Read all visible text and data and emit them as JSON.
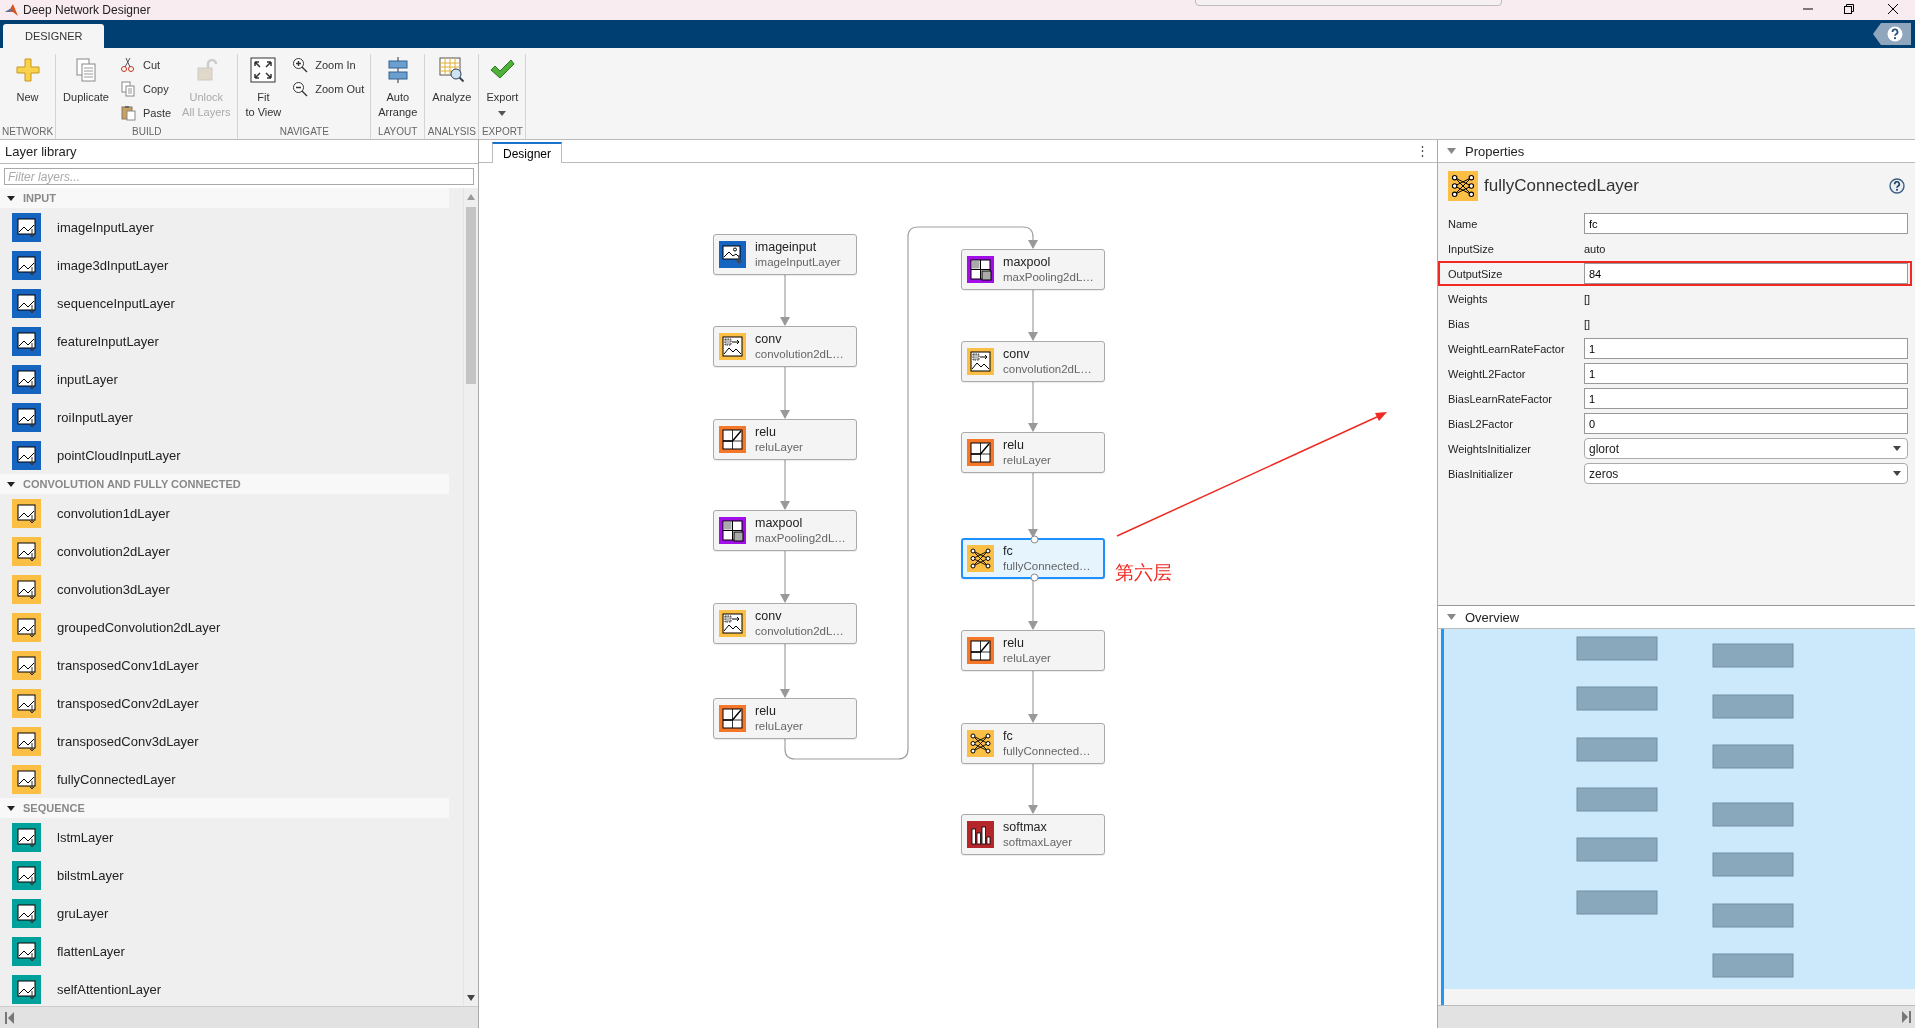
{
  "window": {
    "title": "Deep Network Designer"
  },
  "ribbon_tabs": [
    {
      "label": "DESIGNER",
      "selected": true
    }
  ],
  "toolbar": {
    "sections": [
      {
        "label": "NETWORK",
        "buttons": [
          {
            "label": "New",
            "kind": "large",
            "disabled": false
          }
        ]
      },
      {
        "label": "BUILD",
        "buttons": [
          {
            "label": "Duplicate",
            "kind": "large",
            "disabled": false
          },
          {
            "label": "Cut",
            "kind": "small",
            "disabled": false
          },
          {
            "label": "Copy",
            "kind": "small",
            "disabled": false
          },
          {
            "label": "Paste",
            "kind": "small",
            "disabled": false
          },
          {
            "label": "Unlock\nAll Layers",
            "kind": "large",
            "disabled": true
          }
        ]
      },
      {
        "label": "NAVIGATE",
        "buttons": [
          {
            "label": "Fit\nto View",
            "kind": "large",
            "disabled": false
          },
          {
            "label": "Zoom In",
            "kind": "small",
            "disabled": false
          },
          {
            "label": "Zoom Out",
            "kind": "small",
            "disabled": false
          }
        ]
      },
      {
        "label": "LAYOUT",
        "buttons": [
          {
            "label": "Auto\nArrange",
            "kind": "large",
            "disabled": false
          }
        ]
      },
      {
        "label": "ANALYSIS",
        "buttons": [
          {
            "label": "Analyze",
            "kind": "large",
            "disabled": false
          }
        ]
      },
      {
        "label": "EXPORT",
        "buttons": [
          {
            "label": "Export",
            "kind": "dropdown",
            "disabled": false
          }
        ]
      }
    ]
  },
  "library": {
    "title": "Layer library",
    "filter": {
      "placeholder": "Filter layers..."
    },
    "groups": [
      {
        "label": "INPUT",
        "expanded": true,
        "color": "#1565c0",
        "items": [
          "imageInputLayer",
          "image3dInputLayer",
          "sequenceInputLayer",
          "featureInputLayer",
          "inputLayer",
          "roiInputLayer",
          "pointCloudInputLayer"
        ]
      },
      {
        "label": "CONVOLUTION AND FULLY CONNECTED",
        "expanded": true,
        "color": "#fbbf45",
        "items": [
          "convolution1dLayer",
          "convolution2dLayer",
          "convolution3dLayer",
          "groupedConvolution2dLayer",
          "transposedConv1dLayer",
          "transposedConv2dLayer",
          "transposedConv3dLayer",
          "fullyConnectedLayer"
        ]
      },
      {
        "label": "SEQUENCE",
        "expanded": true,
        "color": "#00a19a",
        "items": [
          "lstmLayer",
          "bilstmLayer",
          "gruLayer",
          "flattenLayer",
          "selfAttentionLayer"
        ]
      }
    ]
  },
  "designer": {
    "tab": {
      "label": "Designer",
      "selected": true
    },
    "menu_glyph": "⋮",
    "layers": [
      {
        "name": "imageinput",
        "type": "imageInputLayer",
        "kind": "input",
        "selected": false
      },
      {
        "name": "conv",
        "type": "convolution2dL…",
        "kind": "conv",
        "selected": false
      },
      {
        "name": "relu",
        "type": "reluLayer",
        "kind": "relu",
        "selected": false
      },
      {
        "name": "maxpool",
        "type": "maxPooling2dL…",
        "kind": "pool",
        "selected": false
      },
      {
        "name": "conv",
        "type": "convolution2dL…",
        "kind": "conv",
        "selected": false
      },
      {
        "name": "relu",
        "type": "reluLayer",
        "kind": "relu",
        "selected": false
      },
      {
        "name": "maxpool",
        "type": "maxPooling2dL…",
        "kind": "pool",
        "selected": false
      },
      {
        "name": "conv",
        "type": "convolution2dL…",
        "kind": "conv",
        "selected": false
      },
      {
        "name": "relu",
        "type": "reluLayer",
        "kind": "relu",
        "selected": false
      },
      {
        "name": "fc",
        "type": "fullyConnected…",
        "kind": "fc",
        "selected": true
      },
      {
        "name": "relu",
        "type": "reluLayer",
        "kind": "relu",
        "selected": false
      },
      {
        "name": "fc",
        "type": "fullyConnected…",
        "kind": "fc",
        "selected": false
      },
      {
        "name": "softmax",
        "type": "softmaxLayer",
        "kind": "softmax",
        "selected": false
      }
    ],
    "annotation": {
      "label": "第六层"
    }
  },
  "properties": {
    "title": "Properties",
    "expanded": true,
    "layer_type": "fullyConnectedLayer",
    "rows": [
      {
        "label": "Name",
        "kind": "input",
        "value": "fc",
        "highlighted": false
      },
      {
        "label": "InputSize",
        "kind": "text",
        "value": "auto",
        "highlighted": false
      },
      {
        "label": "OutputSize",
        "kind": "input",
        "value": "84",
        "highlighted": true
      },
      {
        "label": "Weights",
        "kind": "text",
        "value": "[]",
        "highlighted": false
      },
      {
        "label": "Bias",
        "kind": "text",
        "value": "[]",
        "highlighted": false
      },
      {
        "label": "WeightLearnRateFactor",
        "kind": "input",
        "value": "1",
        "highlighted": false
      },
      {
        "label": "WeightL2Factor",
        "kind": "input",
        "value": "1",
        "highlighted": false
      },
      {
        "label": "BiasLearnRateFactor",
        "kind": "input",
        "value": "1",
        "highlighted": false
      },
      {
        "label": "BiasL2Factor",
        "kind": "input",
        "value": "0",
        "highlighted": false
      },
      {
        "label": "WeightsInitializer",
        "kind": "dropdown",
        "value": "glorot",
        "highlighted": false
      },
      {
        "label": "BiasInitializer",
        "kind": "dropdown",
        "value": "zeros",
        "highlighted": false
      }
    ]
  },
  "overview": {
    "title": "Overview",
    "expanded": true
  }
}
